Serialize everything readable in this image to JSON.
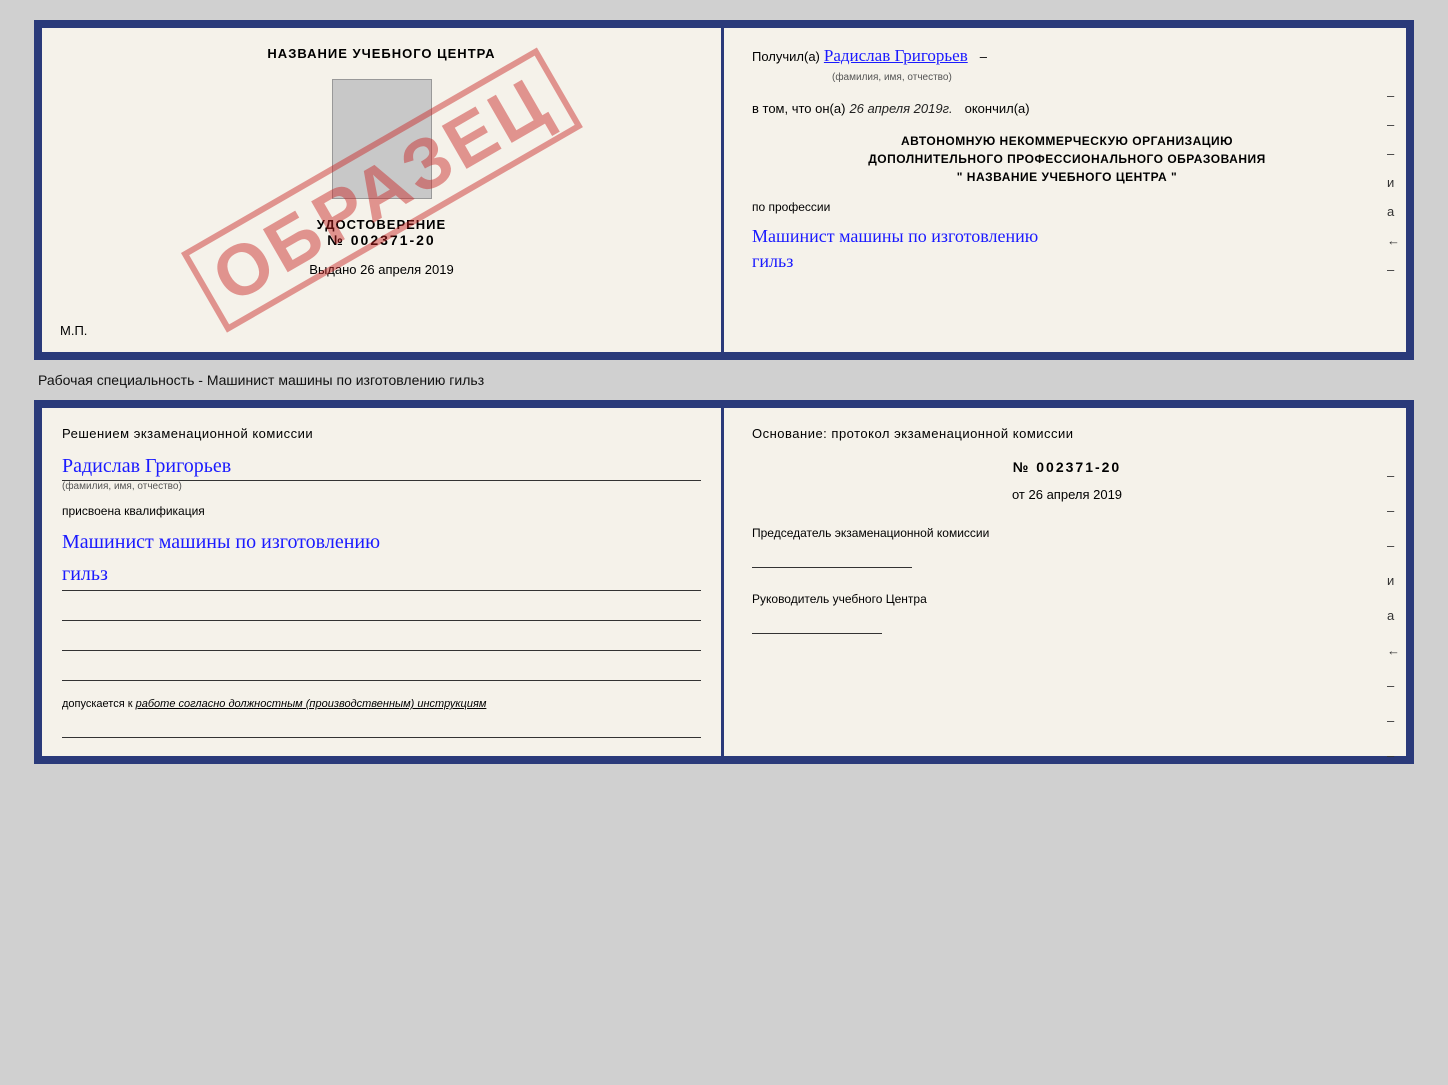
{
  "top_doc": {
    "left": {
      "school_name": "НАЗВАНИЕ УЧЕБНОГО ЦЕНТРА",
      "cert_title": "УДОСТОВЕРЕНИЕ",
      "cert_number": "№ 002371-20",
      "issued_label": "Выдано",
      "issued_date": "26 апреля 2019",
      "mp_label": "М.П.",
      "obrazec": "ОБРАЗЕЦ"
    },
    "right": {
      "received_label": "Получил(а)",
      "name_handwritten": "Радислав Григорьев",
      "name_sub": "(фамилия, имя, отчество)",
      "in_that_label": "в том, что он(а)",
      "date_handwritten": "26 апреля 2019г.",
      "finished_label": "окончил(а)",
      "org_line1": "АВТОНОМНУЮ НЕКОММЕРЧЕСКУЮ ОРГАНИЗАЦИЮ",
      "org_line2": "ДОПОЛНИТЕЛЬНОГО ПРОФЕССИОНАЛЬНОГО ОБРАЗОВАНИЯ",
      "org_name": "\"  НАЗВАНИЕ УЧЕБНОГО ЦЕНТРА  \"",
      "profession_label": "по профессии",
      "profession_handwritten_line1": "Машинист машины по изготовлению",
      "profession_handwritten_line2": "гильз",
      "dashes": [
        "-",
        "-",
        "-",
        "и",
        "а",
        "←",
        "-"
      ]
    }
  },
  "specialty_label": "Рабочая специальность - Машинист машины по изготовлению гильз",
  "bottom_doc": {
    "left": {
      "decision_label": "Решением  экзаменационной  комиссии",
      "name_handwritten": "Радислав Григорьев",
      "name_sub": "(фамилия, имя, отчество)",
      "assigned_label": "присвоена квалификация",
      "profession_handwritten_line1": "Машинист машины по изготовлению",
      "profession_handwritten_line2": "гильз",
      "allowed_prefix": "допускается к",
      "allowed_italic": "работе согласно должностным (производственным) инструкциям"
    },
    "right": {
      "basis_label": "Основание: протокол экзаменационной  комиссии",
      "number": "№  002371-20",
      "date_prefix": "от",
      "date": "26 апреля 2019",
      "chairman_label": "Председатель экзаменационной комиссии",
      "head_label": "Руководитель учебного Центра",
      "dashes": [
        "-",
        "-",
        "-",
        "и",
        "а",
        "←",
        "-",
        "-",
        "-"
      ]
    }
  }
}
